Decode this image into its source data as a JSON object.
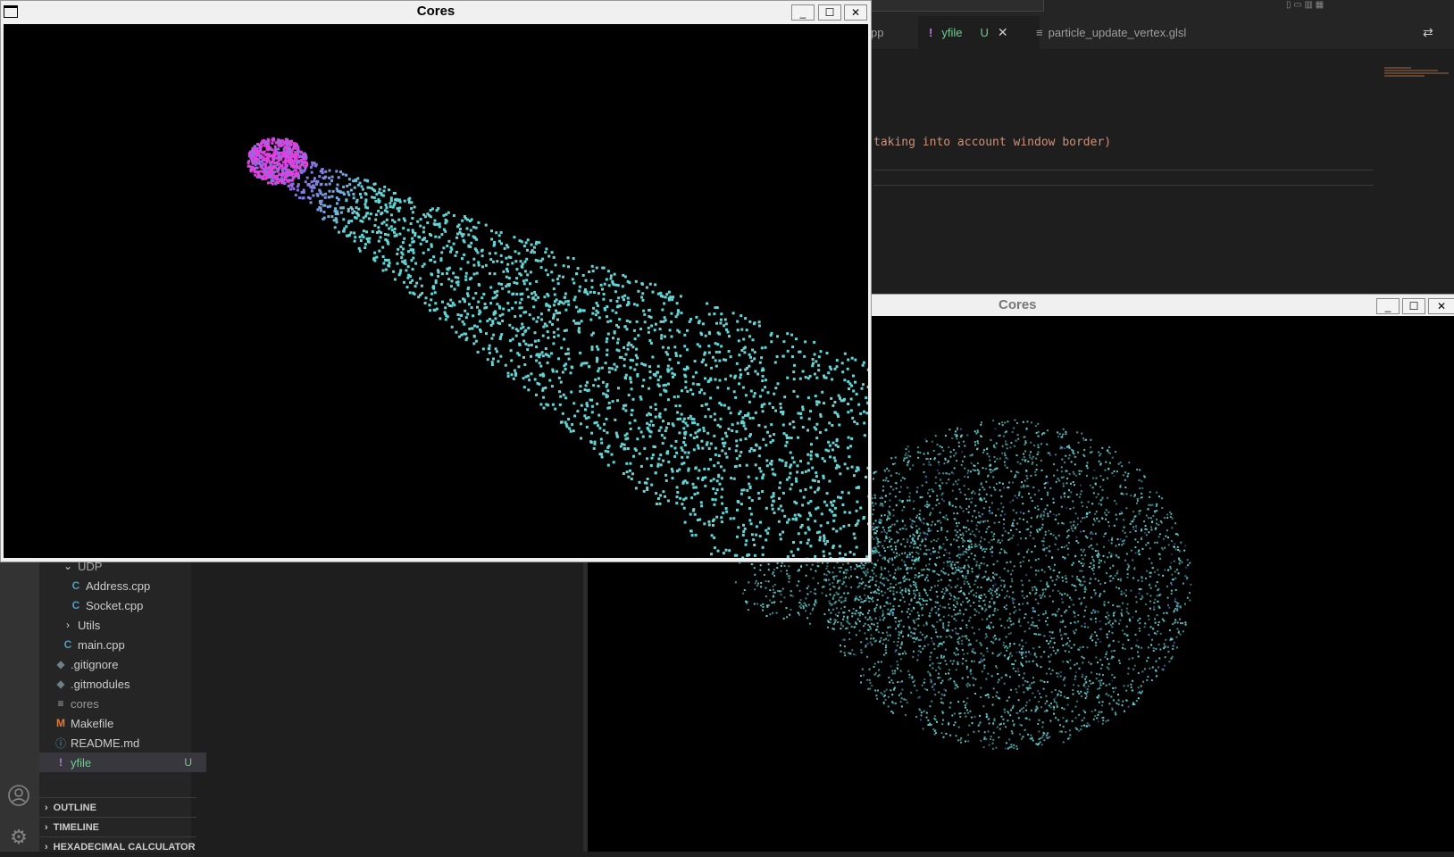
{
  "editor": {
    "tabs": [
      {
        "label": "pp"
      },
      {
        "label": "yfile",
        "badge": "U",
        "icon": "!"
      },
      {
        "label": "particle_update_vertex.glsl",
        "icon": "≡"
      }
    ],
    "code_text": "taking into account window border)"
  },
  "explorer": {
    "items": [
      {
        "label": "UDP",
        "type": "folder-open",
        "indent": 1
      },
      {
        "label": "Address.cpp",
        "type": "cpp",
        "indent": 2
      },
      {
        "label": "Socket.cpp",
        "type": "cpp",
        "indent": 2
      },
      {
        "label": "Utils",
        "type": "folder",
        "indent": 1
      },
      {
        "label": "main.cpp",
        "type": "cpp",
        "indent": 1
      },
      {
        "label": ".gitignore",
        "type": "git",
        "indent": 0
      },
      {
        "label": ".gitmodules",
        "type": "git",
        "indent": 0
      },
      {
        "label": "cores",
        "type": "file",
        "indent": 0
      },
      {
        "label": "Makefile",
        "type": "make",
        "indent": 0
      },
      {
        "label": "README.md",
        "type": "info",
        "indent": 0
      },
      {
        "label": "yfile",
        "type": "yaml",
        "indent": 0,
        "badge": "U"
      }
    ],
    "sections": [
      "OUTLINE",
      "TIMELINE",
      "HEXADECIMAL CALCULATOR"
    ]
  },
  "windows": {
    "front_title": "Cores",
    "back_title": "Cores"
  },
  "colors": {
    "particle_cyan": "#66d4d4",
    "particle_magenta": "#e040e0",
    "particle_purple": "#8a70e0",
    "git_untracked": "#73c991"
  }
}
